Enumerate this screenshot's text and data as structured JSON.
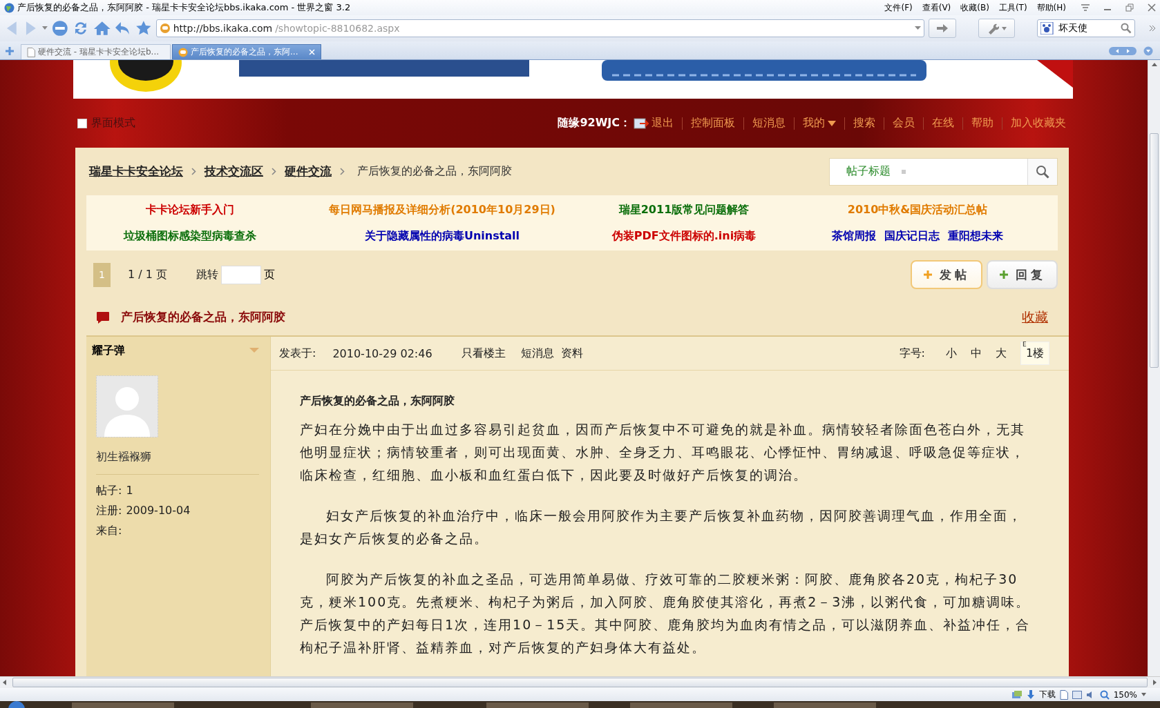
{
  "window": {
    "title": "产后恢复的必备之品，东阿阿胶 - 瑞星卡卡安全论坛bbs.ikaka.com - 世界之窗 3.2"
  },
  "menu": [
    "文件(F)",
    "查看(V)",
    "收藏(B)",
    "工具(T)",
    "帮助(H)"
  ],
  "address": {
    "host": "http://bbs.ikaka.com",
    "path": "/showtopic-8810682.aspx"
  },
  "search_engine": {
    "value": "坏天使"
  },
  "tabs": [
    {
      "label": "硬件交流 - 瑞星卡卡安全论坛b...",
      "selected": false
    },
    {
      "label": "产后恢复的必备之品，东阿...",
      "selected": true
    }
  ],
  "forum": {
    "mode": {
      "label": "界面模式",
      "checked": false
    },
    "user": "随缘92WJC：",
    "logout": "退出",
    "nav": [
      {
        "label": "控制面板",
        "dropdown": false
      },
      {
        "label": "短消息",
        "dropdown": false
      },
      {
        "label": "我的",
        "dropdown": true
      },
      {
        "label": "搜索",
        "dropdown": false
      },
      {
        "label": "会员",
        "dropdown": false
      },
      {
        "label": "在线",
        "dropdown": false
      },
      {
        "label": "帮助",
        "dropdown": false
      },
      {
        "label": "加入收藏夹",
        "dropdown": false
      }
    ],
    "breadcrumb": [
      "瑞星卡卡安全论坛",
      "技术交流区",
      "硬件交流"
    ],
    "current": "产后恢复的必备之品，东阿阿胶",
    "search_scope": "帖子标题",
    "announcements": [
      {
        "links": [
          "卡卡论坛新手入门"
        ],
        "color": "#cc0000"
      },
      {
        "links": [
          "每日网马播报及详细分析(2010年10月29日)"
        ],
        "color": "#e07b00"
      },
      {
        "links": [
          "瑞星2011版常见问题解答"
        ],
        "color": "#0a6e0a"
      },
      {
        "links": [
          "2010中秋&国庆活动汇总帖"
        ],
        "color": "#e07b00"
      },
      {
        "links": [
          "垃圾桶图标感染型病毒查杀"
        ],
        "color": "#0a6e0a"
      },
      {
        "links": [
          "关于隐藏属性的病毒Uninstall"
        ],
        "color": "#0000b0"
      },
      {
        "links": [
          "伪装PDF文件图标的.ini病毒"
        ],
        "color": "#cc0000"
      },
      {
        "links": [
          "茶馆周报",
          "国庆记日志",
          "重阳想未来"
        ],
        "color": "#0000b0"
      }
    ],
    "pager": {
      "current": "1",
      "info": "1 / 1 页",
      "jump": "跳转",
      "unit": "页"
    },
    "buttons": [
      "发 帖",
      "回 复"
    ],
    "topic": "产后恢复的必备之品，东阿阿胶",
    "favorite": "收藏"
  },
  "post": {
    "author": "耀子弹",
    "rank": "初生襁褓狮",
    "stats": [
      {
        "label": "帖子:",
        "value": "1"
      },
      {
        "label": "注册:",
        "value": "2009-10-04"
      },
      {
        "label": "来自:"
      }
    ],
    "posted_label": "发表于:",
    "posted": "2010-10-29 02:46",
    "actions": [
      "只看楼主",
      "短消息",
      "资料"
    ],
    "font_label": "字号:",
    "font_sizes": [
      "小",
      "中",
      "大"
    ],
    "floor_mark": "E",
    "floor": "1楼",
    "title": "产后恢复的必备之品，东阿阿胶",
    "paragraphs": [
      {
        "text": "产妇在分娩中由于出血过多容易引起贫血，因而产后恢复中不可避免的就是补血。病情较轻者除面色苍白外，无其他明显症状；病情较重者，则可出现面黄、水肿、全身乏力、耳鸣眼花、心悸怔忡、胃纳减退、呼吸急促等症状，临床检查，红细胞、血小板和血红蛋白低下，因此要及时做好产后恢复的调治。",
        "indent": false
      },
      {
        "text": "妇女产后恢复的补血治疗中，临床一般会用阿胶作为主要产后恢复补血药物，因阿胶善调理气血，作用全面，是妇女产后恢复的必备之品。",
        "indent": true
      },
      {
        "text": "阿胶为产后恢复的补血之圣品，可选用简单易做、疗效可靠的二胶粳米粥：阿胶、鹿角胶各20克，枸杞子30克，粳米100克。先煮粳米、枸杞子为粥后，加入阿胶、鹿角胶使其溶化，再煮2－3沸，以粥代食，可加糖调味。产后恢复中的产妇每日1次，连用10－15天。其中阿胶、鹿角胶均为血肉有情之品，可以滋阴养血、补益冲任，合枸杞子温补肝肾、益精养血，对产后恢复的产妇身体大有益处。",
        "indent": true
      }
    ]
  },
  "status": {
    "download": "下载",
    "zoom": "150%"
  }
}
